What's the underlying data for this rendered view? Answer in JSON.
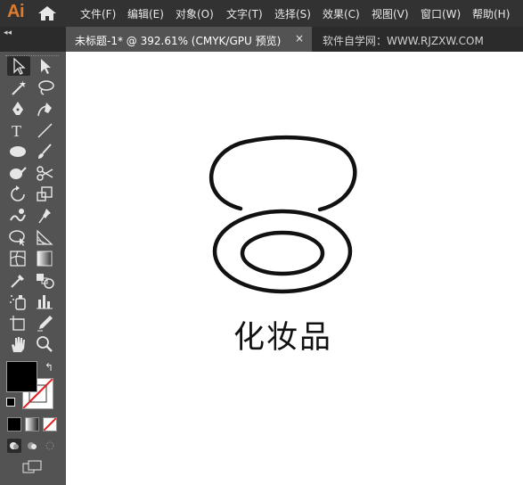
{
  "app": {
    "logo": "Ai"
  },
  "menu": [
    {
      "label": "文件(F)"
    },
    {
      "label": "编辑(E)"
    },
    {
      "label": "对象(O)"
    },
    {
      "label": "文字(T)"
    },
    {
      "label": "选择(S)"
    },
    {
      "label": "效果(C)"
    },
    {
      "label": "视图(V)"
    },
    {
      "label": "窗口(W)"
    },
    {
      "label": "帮助(H)"
    }
  ],
  "tabs": {
    "active_title": "未标题-1* @ 392.61% (CMYK/GPU 预览)",
    "close_glyph": "×",
    "other_text": "软件自学网：WWW.RJZXW.COM"
  },
  "panel": {
    "collapse_glyph": "◂◂"
  },
  "canvas": {
    "logo_text": "化妆品"
  },
  "colors": {
    "fill": "#000000",
    "stroke": "none",
    "accent": "#E07B2C"
  },
  "tools": [
    "selection-tool-icon",
    "direct-selection-tool-icon",
    "magic-wand-tool-icon",
    "lasso-tool-icon",
    "pen-tool-icon",
    "curvature-tool-icon",
    "type-tool-icon",
    "line-segment-tool-icon",
    "ellipse-tool-icon",
    "paintbrush-tool-icon",
    "shaper-tool-icon",
    "scissors-tool-icon",
    "rotate-tool-icon",
    "scale-tool-icon",
    "warp-tool-icon",
    "puppet-warp-tool-icon",
    "free-transform-tool-icon",
    "perspective-grid-tool-icon",
    "mesh-tool-icon",
    "gradient-tool-icon",
    "eyedropper-tool-icon",
    "blend-tool-icon",
    "symbol-sprayer-tool-icon",
    "column-graph-tool-icon",
    "artboard-tool-icon",
    "slice-tool-icon",
    "hand-tool-icon",
    "zoom-tool-icon"
  ]
}
